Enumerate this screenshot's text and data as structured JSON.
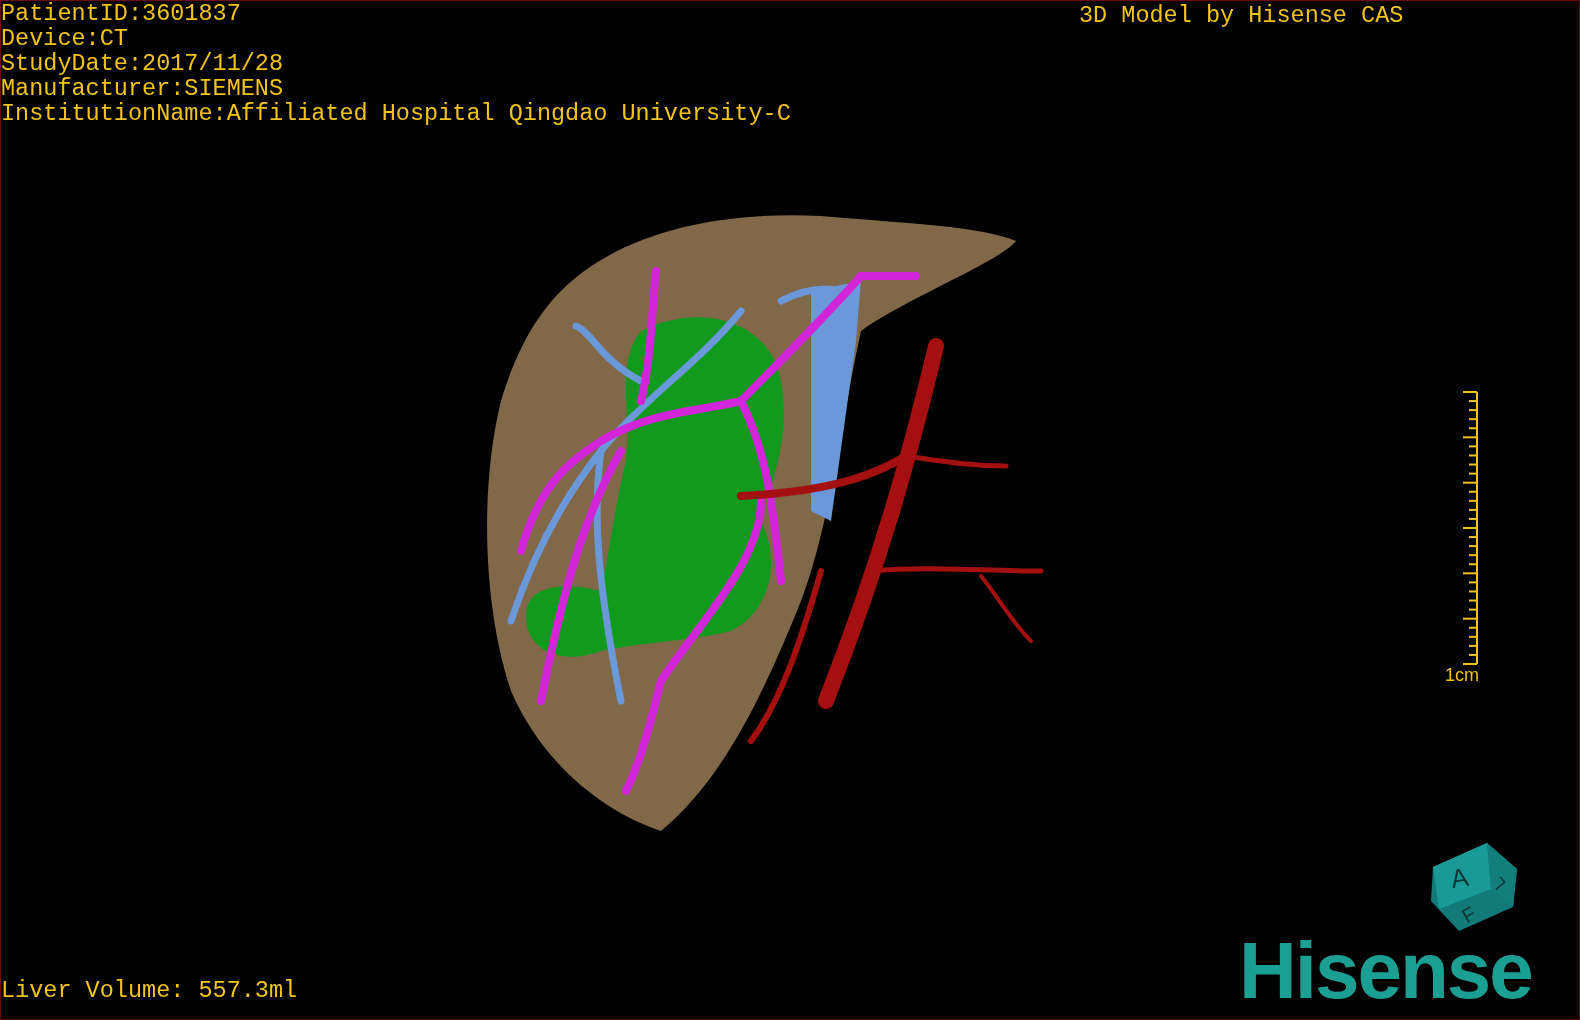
{
  "patient_info": [
    "PatientID:3601837",
    "Device:CT",
    "StudyDate:2017/11/28",
    "Manufacturer:SIEMENS",
    "InstitutionName:Affiliated Hospital Qingdao University-C"
  ],
  "title": "3D Model by Hisense CAS",
  "scale_bar": {
    "label": "1cm"
  },
  "orientation_cube": {
    "labels": [
      "A",
      "L",
      "F"
    ]
  },
  "logo": "Hisense",
  "liver_volume": "Liver Volume: 557.3ml"
}
